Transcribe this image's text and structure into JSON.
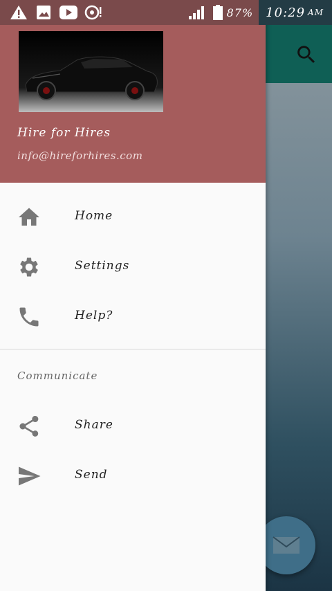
{
  "statusbar": {
    "battery_percent": "87%",
    "time": "10:29",
    "ampm": "AM",
    "icons": [
      "warning-icon",
      "image-icon",
      "youtube-icon",
      "sync-icon",
      "signal-icon",
      "battery-icon"
    ]
  },
  "drawer": {
    "header": {
      "name": "Hire for Hires",
      "email": "info@hireforhires.com"
    },
    "items": [
      {
        "label": "Home",
        "icon": "home-icon"
      },
      {
        "label": "Settings",
        "icon": "gear-icon"
      },
      {
        "label": "Help?",
        "icon": "phone-icon"
      }
    ],
    "section_title": "Communicate",
    "section_items": [
      {
        "label": "Share",
        "icon": "share-icon"
      },
      {
        "label": "Send",
        "icon": "send-icon"
      }
    ]
  },
  "colors": {
    "header": "#a55c5c",
    "appbar": "#0f5f55",
    "statusbar": "#7a4a4b",
    "icon": "#777777"
  }
}
